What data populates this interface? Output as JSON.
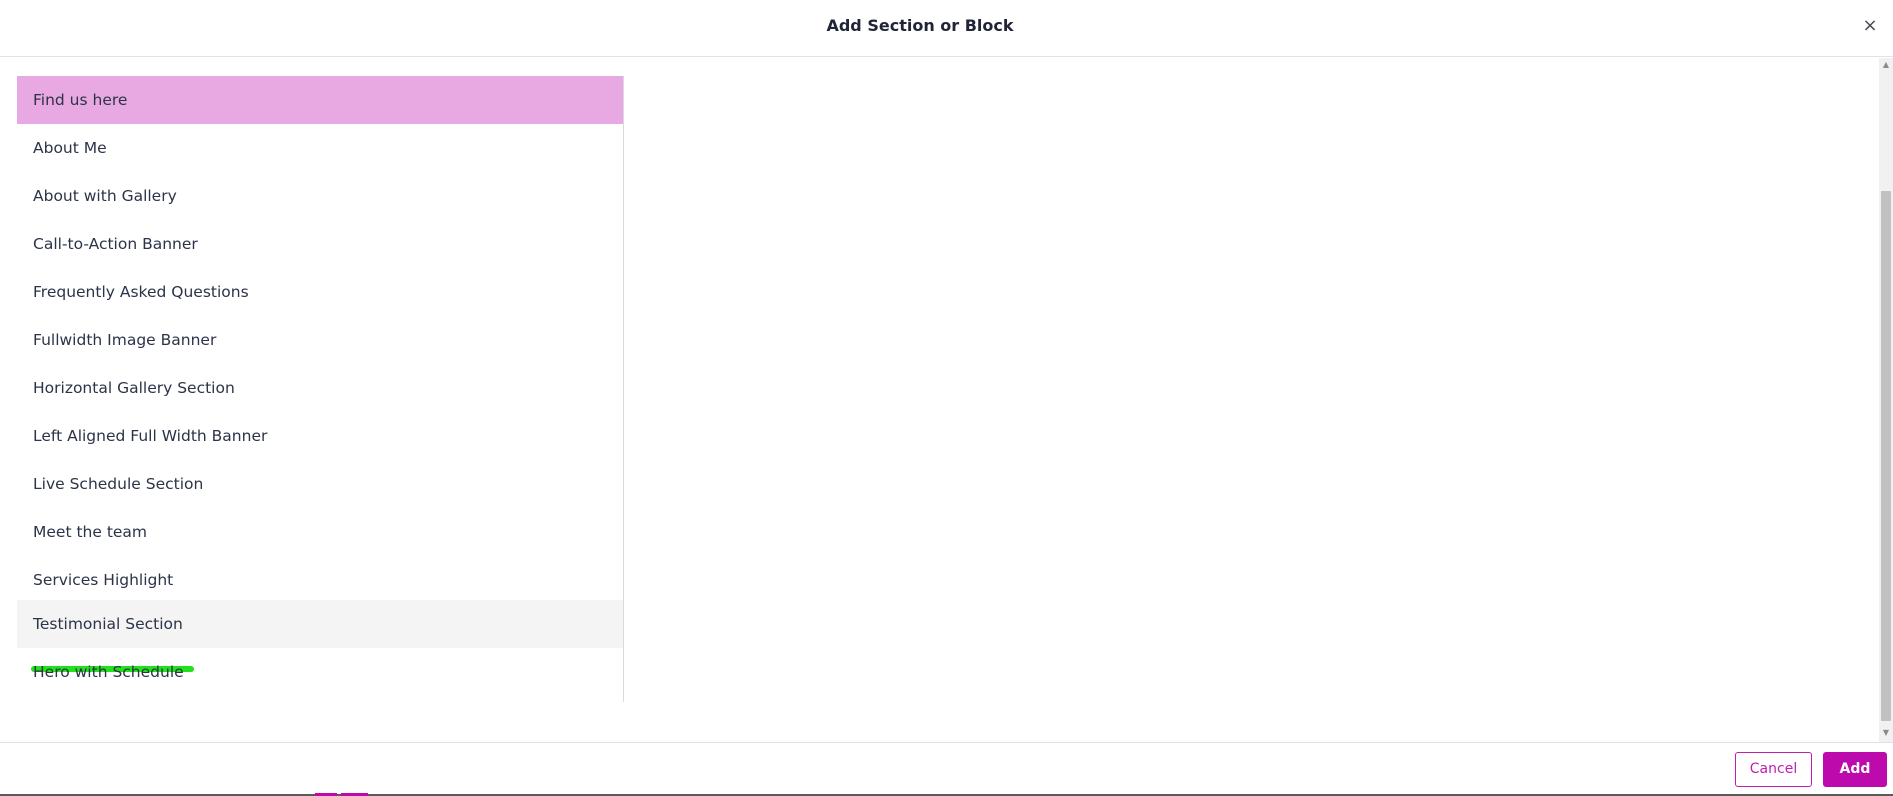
{
  "dialog": {
    "title": "Add Section or Block",
    "close_icon": "×"
  },
  "list": {
    "selected_index": 0,
    "hovered_index": 11,
    "items": [
      {
        "label": "Find us here"
      },
      {
        "label": "About Me"
      },
      {
        "label": "About with Gallery"
      },
      {
        "label": "Call-to-Action Banner"
      },
      {
        "label": "Frequently Asked Questions"
      },
      {
        "label": "Fullwidth Image Banner"
      },
      {
        "label": "Horizontal Gallery Section"
      },
      {
        "label": "Left Aligned Full Width Banner"
      },
      {
        "label": "Live Schedule Section"
      },
      {
        "label": "Meet the team"
      },
      {
        "label": "Services Highlight"
      },
      {
        "label": "Testimonial Section"
      },
      {
        "label": "Hero with Schedule"
      }
    ]
  },
  "footer": {
    "cancel_label": "Cancel",
    "add_label": "Add"
  },
  "colors": {
    "accent": "#bc0aad",
    "selected_item_bg": "#e8a8e1",
    "hover_item_bg": "#f4f4f5",
    "hover_underline": "#21e21a"
  },
  "scrollbar": {
    "up_icon": "▲",
    "down_icon": "▼"
  }
}
